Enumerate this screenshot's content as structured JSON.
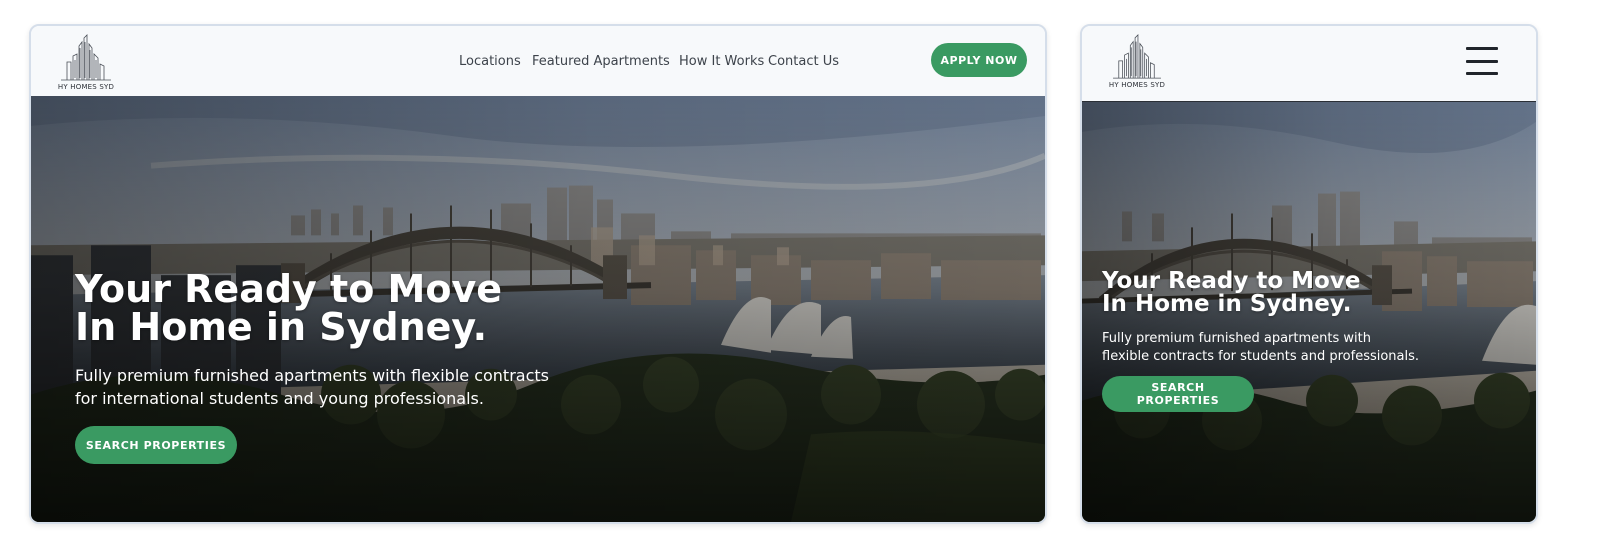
{
  "brand": {
    "logo_text": "HY HOMES SYD",
    "accent_color": "#3a9a62"
  },
  "desktop": {
    "nav": [
      {
        "label": "Locations"
      },
      {
        "label": "Featured Apartments"
      },
      {
        "label": "How It Works"
      },
      {
        "label": "Contact Us"
      }
    ],
    "apply_label": "APPLY NOW",
    "hero": {
      "title_line1": "Your Ready to Move",
      "title_line2": "In Home in Sydney.",
      "subtitle_line1": "Fully premium furnished apartments with flexible contracts",
      "subtitle_line2": "for international students and young professionals.",
      "cta_label": "SEARCH PROPERTIES"
    }
  },
  "mobile": {
    "menu_icon": "hamburger-menu-icon",
    "hero": {
      "title_line1": "Your Ready to Move",
      "title_line2": "In Home in Sydney.",
      "subtitle_line1": "Fully premium furnished apartments with",
      "subtitle_line2": "flexible contracts for students and professionals.",
      "cta_label": "SEARCH PROPERTIES"
    }
  }
}
